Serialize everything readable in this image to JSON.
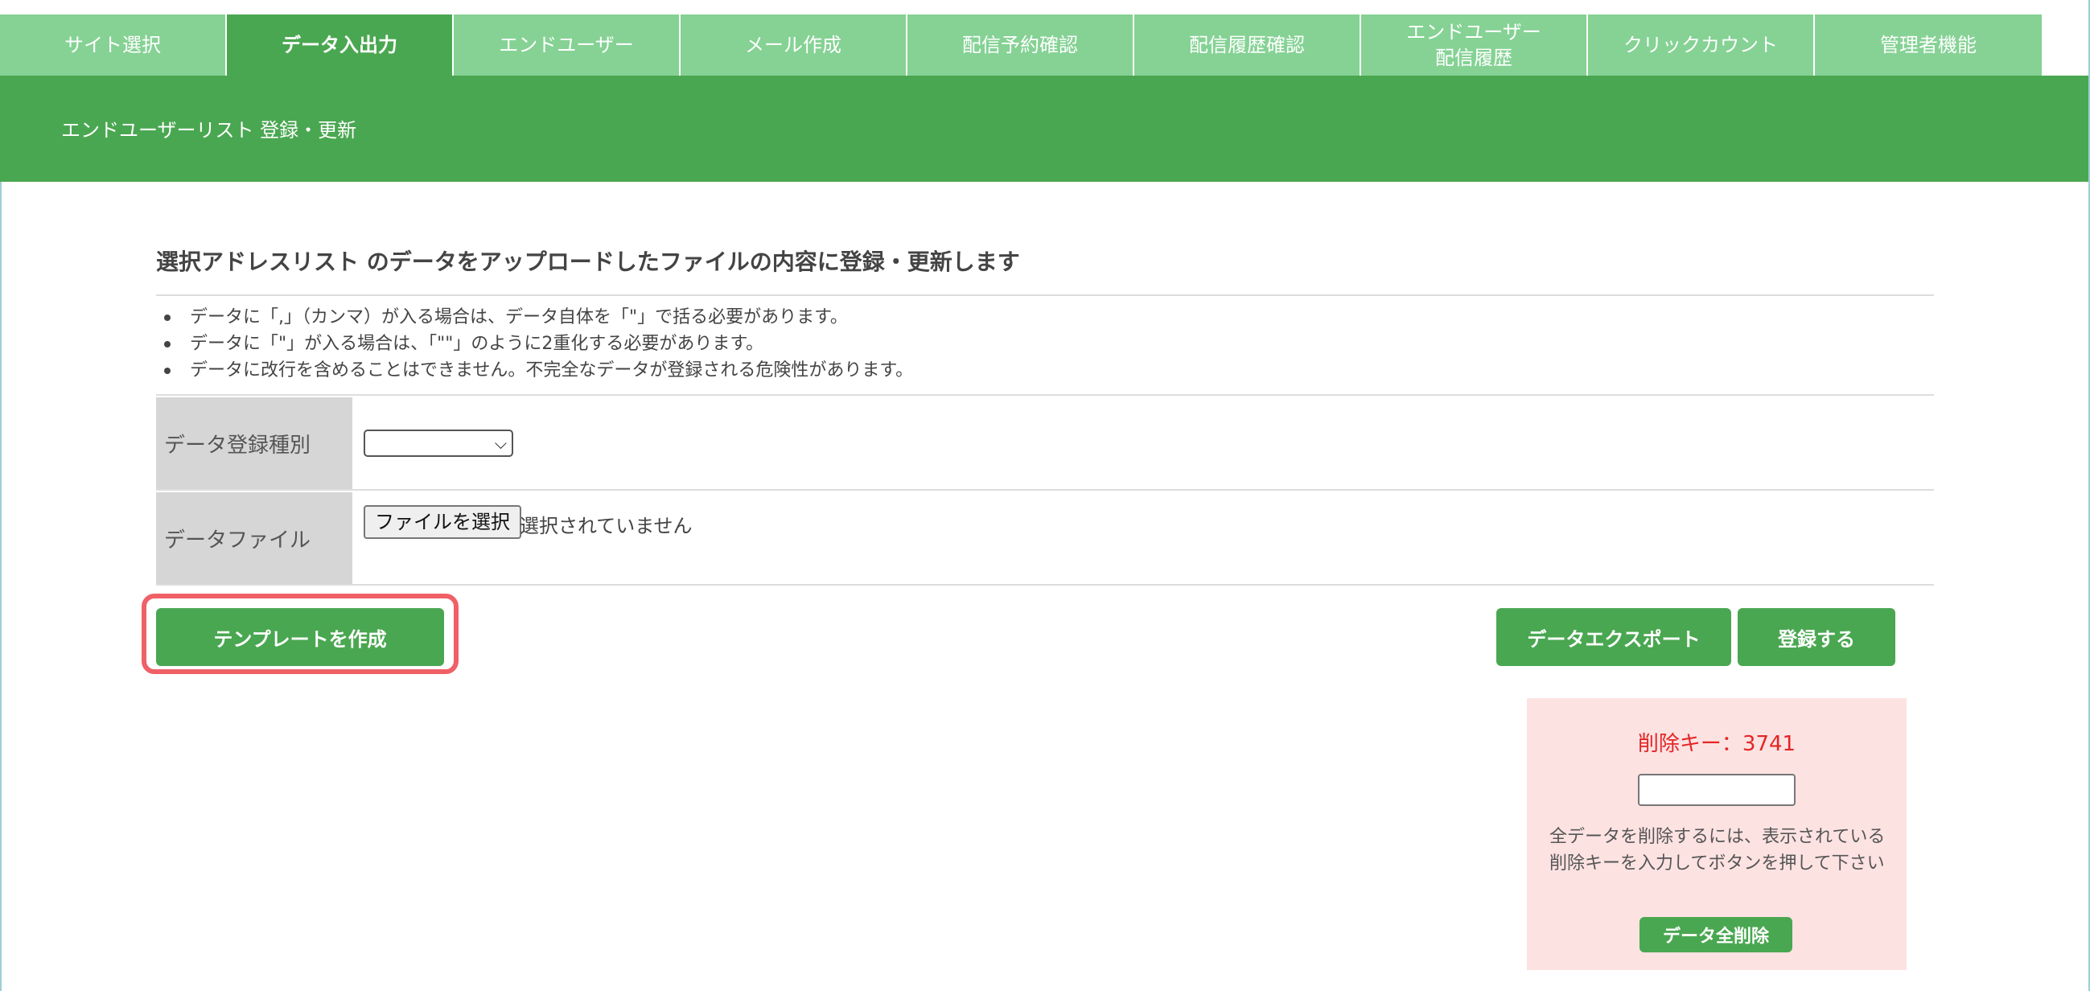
{
  "tabs": [
    {
      "label": "サイト選択",
      "active": false
    },
    {
      "label": "データ入出力",
      "active": true
    },
    {
      "label": "エンドユーザー",
      "active": false
    },
    {
      "label": "メール作成",
      "active": false
    },
    {
      "label": "配信予約確認",
      "active": false
    },
    {
      "label": "配信履歴確認",
      "active": false
    },
    {
      "label_line1": "エンドユーザー",
      "label_line2": "配信履歴",
      "active": false
    },
    {
      "label": "クリックカウント",
      "active": false
    },
    {
      "label": "管理者機能",
      "active": false
    }
  ],
  "header": {
    "title": "エンドユーザーリスト 登録・更新"
  },
  "main": {
    "section_title": "選択アドレスリスト のデータをアップロードしたファイルの内容に登録・更新します",
    "notes": [
      "データに「,」（カンマ）が入る場合は、データ自体を「\"」で括る必要があります。",
      "データに「\"」が入る場合は、「\"\"」のように2重化する必要があります。",
      "データに改行を含めることはできません。不完全なデータが登録される危険性があります。"
    ],
    "form": {
      "type_label": "データ登録種別",
      "type_value": "",
      "file_label": "データファイル",
      "file_button": "ファイルを選択",
      "file_status": "選択されていません"
    },
    "buttons": {
      "create_template": "テンプレートを作成",
      "export": "データエクスポート",
      "register": "登録する"
    }
  },
  "delete_panel": {
    "key_text": "削除キー：3741",
    "input_value": "",
    "description": "全データを削除するには、表示されている削除キーを入力してボタンを押して下さい",
    "button": "データ全削除"
  },
  "colors": {
    "tab_inactive": "#85d294",
    "tab_active": "#4aa751",
    "header": "#4aa751",
    "button": "#4aa751",
    "highlight": "#f06067",
    "delete_panel_bg": "#fde2e2",
    "delete_key_text": "#e32626"
  },
  "icons": {
    "select_arrow": "chevron-down-icon"
  }
}
